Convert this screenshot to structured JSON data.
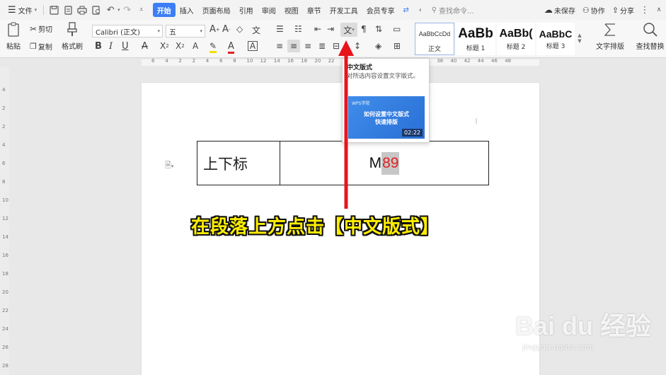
{
  "menubar": {
    "file_label": "文件",
    "tabs": [
      "开始",
      "插入",
      "页面布局",
      "引用",
      "审阅",
      "视图",
      "章节",
      "开发工具",
      "会员专享"
    ],
    "active_tab": "开始",
    "search_placeholder": "查找命令...",
    "unsaved_label": "未保存",
    "collab_label": "协作",
    "share_label": "分享"
  },
  "ribbon": {
    "paste_label": "粘贴",
    "cut_label": "剪切",
    "copy_label": "复制",
    "format_painter_label": "格式刷",
    "font_name": "Calibri (正文)",
    "font_size": "五",
    "styles": [
      {
        "sample": "AaBbCcDd",
        "name": "正文"
      },
      {
        "sample": "AaBb",
        "name": "标题 1"
      },
      {
        "sample": "AaBb(",
        "name": "标题 2"
      },
      {
        "sample": "AaBbC",
        "name": "标题 3"
      }
    ],
    "text_layout_label": "文字排版",
    "find_replace_label": "查找替换"
  },
  "ruler": {
    "h_ticks": [
      "6",
      "4",
      "2",
      "2",
      "4",
      "6",
      "8",
      "10",
      "12",
      "14",
      "16",
      "18",
      "20",
      "22",
      "24",
      "26",
      "28",
      "30",
      "32",
      "34",
      "36",
      "38",
      "40",
      "42",
      "44",
      "46",
      "48"
    ],
    "v_ticks": [
      "4",
      "2",
      "2",
      "4",
      "6",
      "8",
      "10",
      "12",
      "14",
      "16",
      "18",
      "20",
      "22",
      "24",
      "26",
      "28"
    ]
  },
  "document": {
    "cell_left": "上下标",
    "cell_right_prefix": "M",
    "cell_right_selected": "89"
  },
  "tooltip": {
    "title": "中文版式",
    "description": "对所选内容设置文字版式。",
    "video_logo": "WPS学院",
    "video_title_line1": "如何设置中文版式",
    "video_title_line2": "快速排版",
    "video_duration": "02:22"
  },
  "annotation": {
    "caption": "在段落上方点击【中文版式】",
    "arrow_color": "#e8141c",
    "caption_color": "#ffee00"
  },
  "watermark": {
    "brand": "Bai du 经验",
    "url": "jingyan.baidu.com"
  }
}
